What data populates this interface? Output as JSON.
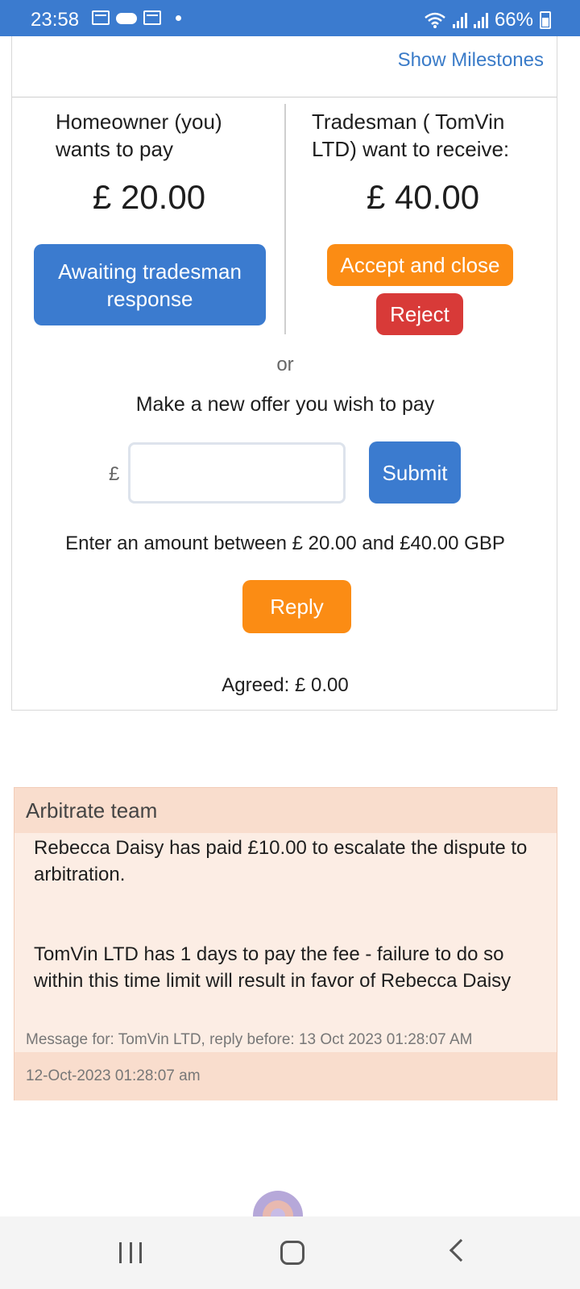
{
  "status_bar": {
    "time": "23:58",
    "battery": "66%"
  },
  "offer": {
    "show_milestones": "Show Milestones",
    "homeowner_label": "Homeowner (you) wants to pay",
    "homeowner_amount": "£ 20.00",
    "tradesman_label": "Tradesman ( TomVin LTD) want to receive:",
    "tradesman_amount": "£ 40.00",
    "awaiting_button": "Awaiting tradesman response",
    "accept_button": "Accept and close",
    "reject_button": "Reject",
    "or": "or",
    "new_offer_prompt": "Make a new offer you wish to pay",
    "currency_symbol": "£",
    "input_value": "",
    "submit_button": "Submit",
    "range_hint": "Enter an amount between £ 20.00 and £40.00 GBP",
    "reply_button": "Reply",
    "agreed": "Agreed: £ 0.00"
  },
  "message": {
    "header": "Arbitrate team",
    "paragraph_1": "Rebecca Daisy has paid £10.00 to escalate the dispute to arbitration.",
    "paragraph_2": "TomVin LTD has 1 days to pay the fee - failure to do so within this time limit will result in favor of Rebecca Daisy",
    "meta": "Message for: TomVin LTD, reply before: 13 Oct 2023 01:28:07 AM",
    "timestamp": "12-Oct-2023 01:28:07 am"
  },
  "icons": [
    "calendar-icon",
    "cloud-icon",
    "calendar-icon",
    "wifi-icon",
    "signal-icon",
    "battery-icon",
    "recent-apps-icon",
    "home-icon",
    "back-icon"
  ]
}
